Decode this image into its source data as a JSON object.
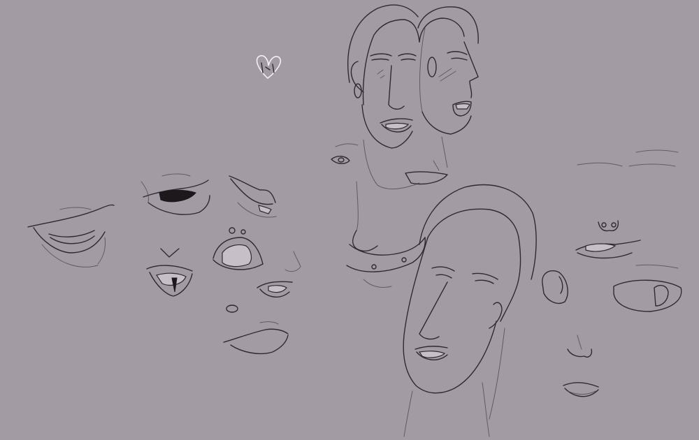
{
  "canvas": {
    "background_color": "#a39ba3",
    "line_color": "#2e2a30",
    "highlight_color": "#f4f0f4"
  },
  "sketches": [
    {
      "name": "heart-doodle"
    },
    {
      "name": "mouth-study-open-left"
    },
    {
      "name": "mouth-study-upper-lips"
    },
    {
      "name": "mouth-study-smirk"
    },
    {
      "name": "mouth-study-teeth-front"
    },
    {
      "name": "mouth-study-round-open"
    },
    {
      "name": "mouth-study-side-open"
    },
    {
      "name": "mouth-study-closed"
    },
    {
      "name": "head-study-front-grin"
    },
    {
      "name": "head-study-side-laughing"
    },
    {
      "name": "head-study-frontal-large"
    },
    {
      "name": "face-study-right-features"
    }
  ]
}
